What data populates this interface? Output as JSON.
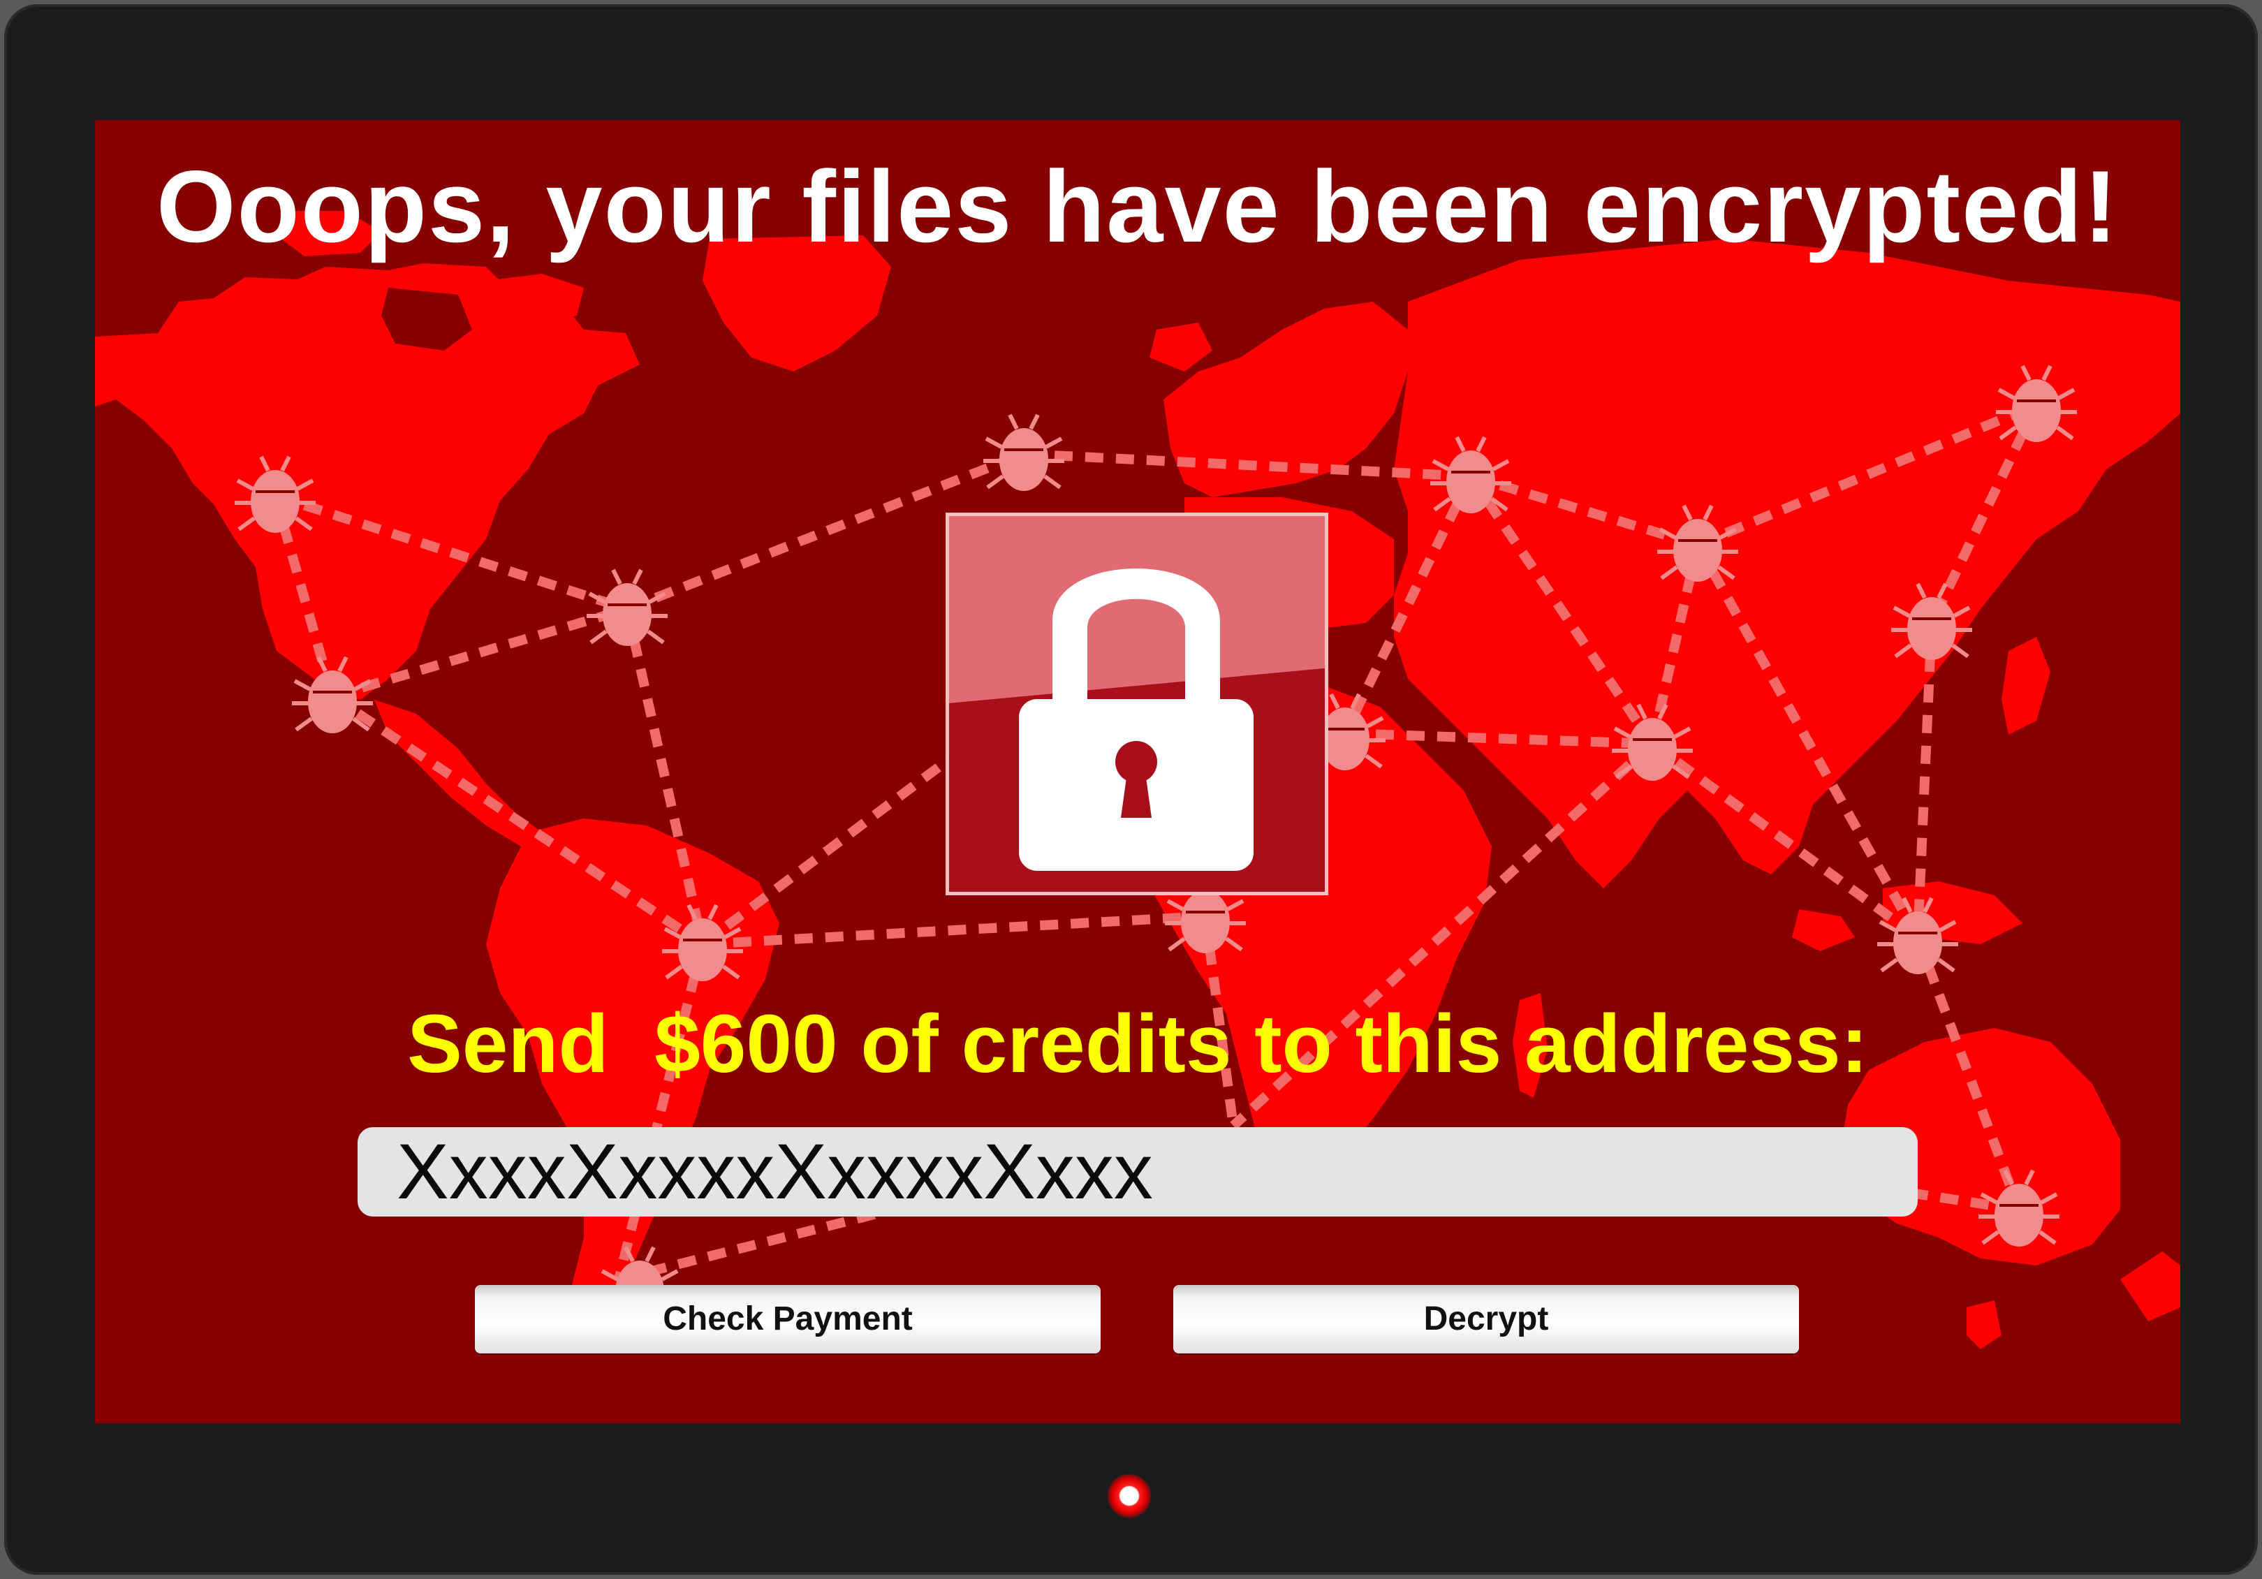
{
  "window": {
    "headline": "Ooops, your files have been encrypted!",
    "instruction": "Send  $600 of credits to this address:",
    "address": "XxxxXxxxxXxxxxXxxx"
  },
  "buttons": {
    "check_payment_label": "Check Payment",
    "decrypt_label": "Decrypt"
  },
  "icons": {
    "lock": "padlock-icon",
    "infected_node": "bug-icon",
    "power": "power-led-icon"
  },
  "colors": {
    "screen_background": "#870000",
    "map_landmass": "#ff0000",
    "headline_text": "#ffffff",
    "instruction_text": "#ffff00",
    "network_links": "#f26a6a",
    "bug_nodes": "#f28c8c",
    "bezel": "#1c1c1c",
    "address_field": "#e4e4e4"
  }
}
